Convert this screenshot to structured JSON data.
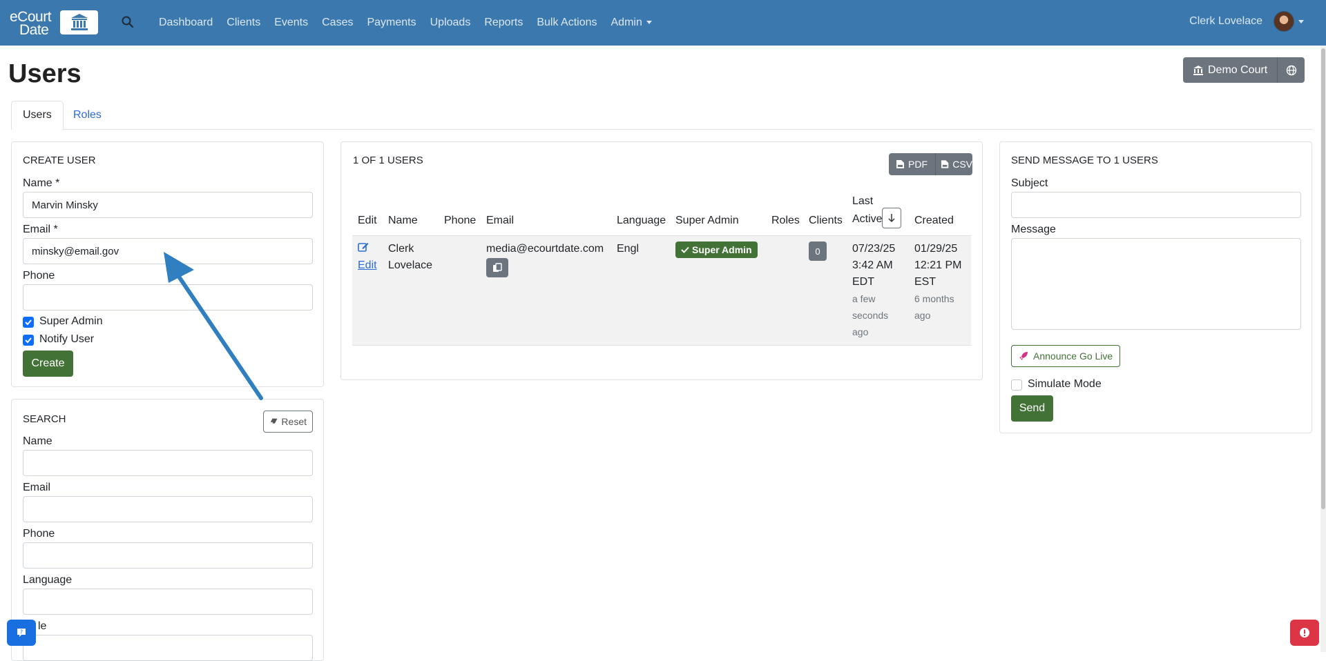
{
  "navbar": {
    "logo_line1": "eCourt",
    "logo_line2": "Date",
    "links": [
      "Dashboard",
      "Clients",
      "Events",
      "Cases",
      "Payments",
      "Uploads",
      "Reports",
      "Bulk Actions",
      "Admin"
    ],
    "user_name": "Clerk Lovelace",
    "icons": {
      "search": "search-icon",
      "logo": "courthouse-icon",
      "user_menu": "chevron-down-icon"
    }
  },
  "page": {
    "title": "Users",
    "court_button": "Demo Court"
  },
  "tabs": [
    "Users",
    "Roles"
  ],
  "create_user": {
    "title": "CREATE USER",
    "name_label": "Name *",
    "name_value": "Marvin Minsky",
    "email_label": "Email *",
    "email_value": "minsky@email.gov",
    "phone_label": "Phone",
    "phone_value": "",
    "super_admin_label": "Super Admin",
    "super_admin_checked": true,
    "notify_label": "Notify User",
    "notify_checked": true,
    "create_button": "Create"
  },
  "search": {
    "title": "SEARCH",
    "reset_button": "Reset",
    "name_label": "Name",
    "email_label": "Email",
    "phone_label": "Phone",
    "language_label": "Language",
    "role_label_partial": "le"
  },
  "users_table": {
    "count_label": "1 OF 1 USERS",
    "pdf_button": "PDF",
    "csv_button": "CSV",
    "headers": [
      "Edit",
      "Name",
      "Phone",
      "Email",
      "Language",
      "Super Admin",
      "Roles",
      "Clients",
      "Last Active",
      "Created"
    ],
    "rows": [
      {
        "edit": "Edit",
        "name_line1": "Clerk",
        "name_line2": "Lovelace",
        "phone": "",
        "email": "media@ecourtdate.com",
        "language": "Engl",
        "super_admin_badge": "Super Admin",
        "roles": "",
        "clients": "0",
        "last_active": [
          "07/23/25",
          "3:42 AM",
          "EDT"
        ],
        "last_active_rel": [
          "a few",
          "seconds",
          "ago"
        ],
        "created": [
          "01/29/25",
          "12:21 PM",
          "EST"
        ],
        "created_rel": [
          "6 months",
          "ago"
        ]
      }
    ]
  },
  "send_message": {
    "title": "SEND MESSAGE TO 1 USERS",
    "subject_label": "Subject",
    "message_label": "Message",
    "announce_button": "Announce Go Live",
    "simulate_label": "Simulate Mode",
    "simulate_checked": false,
    "send_button": "Send"
  },
  "colors": {
    "navbar": "#3b78ad",
    "primary_green": "#437236",
    "secondary_gray": "#6c757d",
    "link_blue": "#2b6cd4",
    "annotation_arrow": "#2f7fc1"
  }
}
